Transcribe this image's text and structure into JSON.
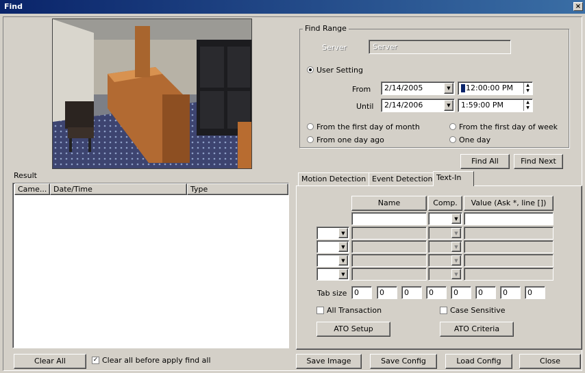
{
  "window": {
    "title": "Find",
    "close_glyph": "×"
  },
  "result": {
    "label": "Result",
    "columns": [
      "Came...",
      "Date/Time",
      "Type"
    ]
  },
  "find_range": {
    "title": "Find Range",
    "disabled_label": "Server",
    "disabled_value": "Server",
    "user_setting_label": "User Setting",
    "from_label": "From",
    "until_label": "Until",
    "from_date": "2/14/2005",
    "from_time": "12:00:00 PM",
    "until_date": "2/14/2006",
    "until_time": "1:59:00 PM",
    "options": [
      "From the first day of month",
      "From the first day of week",
      "From one day ago",
      "One day"
    ]
  },
  "buttons": {
    "find_all": "Find All",
    "find_next": "Find Next",
    "clear_all": "Clear All",
    "save_image": "Save Image",
    "save_config": "Save Config",
    "load_config": "Load Config",
    "close": "Close",
    "ato_setup": "ATO Setup",
    "ato_criteria": "ATO Criteria"
  },
  "clear_before_label": "Clear all before apply find all",
  "tabs": [
    "Motion Detection",
    "Event Detection",
    "Text-In"
  ],
  "text_in": {
    "headers": {
      "name": "Name",
      "comp": "Comp.",
      "value": "Value (Ask *, line [])"
    },
    "tab_size_label": "Tab size",
    "tab_sizes": [
      "0",
      "0",
      "0",
      "0",
      "0",
      "0",
      "0",
      "0"
    ],
    "all_transaction": "All Transaction",
    "case_sensitive": "Case Sensitive"
  },
  "colors": {
    "title_start": "#0a246a",
    "title_end": "#3a6ea5",
    "face": "#d4d0c8"
  }
}
